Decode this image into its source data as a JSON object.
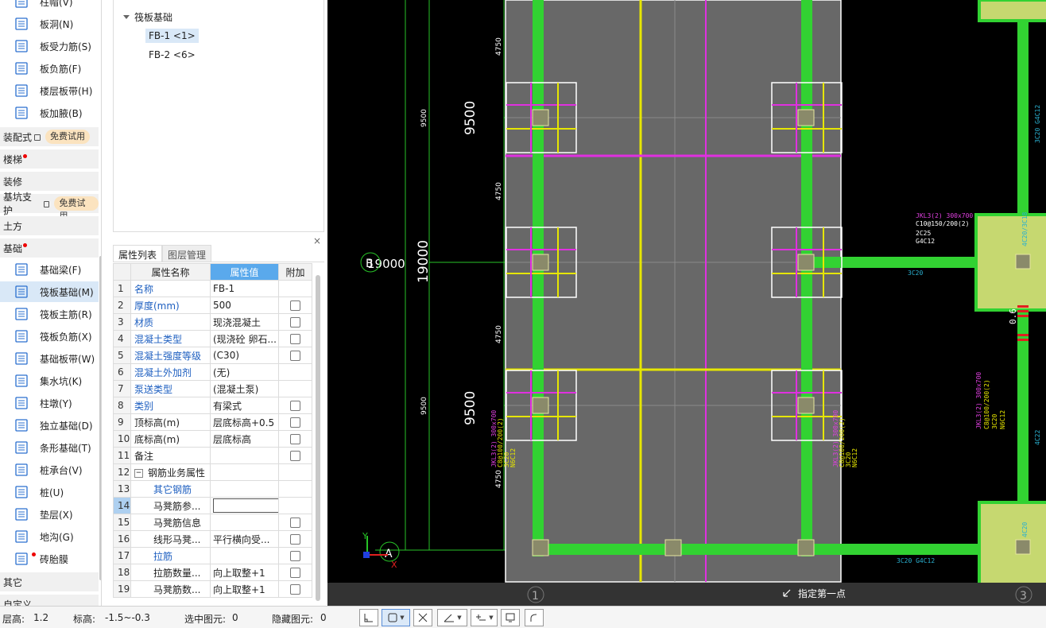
{
  "nav": {
    "top_items": [
      {
        "label": "柱帽(V)",
        "icon": "column-cap-icon"
      },
      {
        "label": "板洞(N)",
        "icon": "slab-hole-icon"
      },
      {
        "label": "板受力筋(S)",
        "icon": "slab-main-rebar-icon"
      },
      {
        "label": "板负筋(F)",
        "icon": "slab-negative-rebar-icon"
      },
      {
        "label": "楼层板带(H)",
        "icon": "floor-strip-icon"
      },
      {
        "label": "板加腋(B)",
        "icon": "slab-haunch-icon"
      }
    ],
    "categories": [
      {
        "label": "装配式",
        "locked": true,
        "trial": "免费试用"
      },
      {
        "label": "楼梯",
        "dot": true
      },
      {
        "label": "装修"
      },
      {
        "label": "基坑支护",
        "locked": true,
        "trial": "免费试用"
      },
      {
        "label": "土方"
      },
      {
        "label": "基础",
        "dot": true
      }
    ],
    "foundation_items": [
      {
        "label": "基础梁(F)",
        "icon": "foundation-beam-icon"
      },
      {
        "label": "筏板基础(M)",
        "icon": "raft-foundation-icon",
        "selected": true
      },
      {
        "label": "筏板主筋(R)",
        "icon": "raft-main-rebar-icon"
      },
      {
        "label": "筏板负筋(X)",
        "icon": "raft-negative-rebar-icon"
      },
      {
        "label": "基础板带(W)",
        "icon": "foundation-strip-icon"
      },
      {
        "label": "集水坑(K)",
        "icon": "sump-pit-icon"
      },
      {
        "label": "柱墩(Y)",
        "icon": "column-pier-icon"
      },
      {
        "label": "独立基础(D)",
        "icon": "isolated-footing-icon"
      },
      {
        "label": "条形基础(T)",
        "icon": "strip-footing-icon"
      },
      {
        "label": "桩承台(V)",
        "icon": "pile-cap-icon"
      },
      {
        "label": "桩(U)",
        "icon": "pile-icon"
      },
      {
        "label": "垫层(X)",
        "icon": "cushion-layer-icon"
      },
      {
        "label": "地沟(G)",
        "icon": "trench-icon"
      },
      {
        "label": "砖胎膜",
        "icon": "brick-mould-icon",
        "dot": true
      }
    ],
    "bottom_categories": [
      {
        "label": "其它"
      },
      {
        "label": "自定义"
      }
    ]
  },
  "tree": {
    "root": "筏板基础",
    "children": [
      {
        "label": "FB-1 <1>",
        "selected": true
      },
      {
        "label": "FB-2 <6>"
      }
    ]
  },
  "props": {
    "close": "×",
    "tabs": [
      {
        "label": "属性列表",
        "active": true
      },
      {
        "label": "图层管理"
      }
    ],
    "headers": {
      "name": "属性名称",
      "value": "属性值",
      "extra": "附加"
    },
    "rows": [
      {
        "n": "1",
        "name": "名称",
        "value": "FB-1",
        "blue": true,
        "check": false
      },
      {
        "n": "2",
        "name": "厚度(mm)",
        "value": "500",
        "blue": true,
        "check": true
      },
      {
        "n": "3",
        "name": "材质",
        "value": "现浇混凝土",
        "blue": true,
        "check": true
      },
      {
        "n": "4",
        "name": "混凝土类型",
        "value": "(现浇砼 卵石...",
        "blue": true,
        "check": true
      },
      {
        "n": "5",
        "name": "混凝土强度等级",
        "value": "(C30)",
        "blue": true,
        "check": true
      },
      {
        "n": "6",
        "name": "混凝土外加剂",
        "value": "(无)",
        "blue": true,
        "check": false
      },
      {
        "n": "7",
        "name": "泵送类型",
        "value": "(混凝土泵)",
        "blue": true,
        "check": false
      },
      {
        "n": "8",
        "name": "类别",
        "value": "有梁式",
        "blue": true,
        "check": true
      },
      {
        "n": "9",
        "name": "顶标高(m)",
        "value": "层底标高+0.5",
        "blue": false,
        "check": true
      },
      {
        "n": "10",
        "name": "底标高(m)",
        "value": "层底标高",
        "blue": false,
        "check": true
      },
      {
        "n": "11",
        "name": "备注",
        "value": "",
        "blue": false,
        "check": true
      },
      {
        "n": "12",
        "name": "钢筋业务属性",
        "value": "",
        "blue": false,
        "check": false,
        "group": true
      },
      {
        "n": "13",
        "name": "其它钢筋",
        "value": "",
        "blue": true,
        "check": false,
        "indent": true
      },
      {
        "n": "14",
        "name": "马凳筋参...",
        "value": "",
        "blue": false,
        "check": false,
        "indent": true,
        "editing": true,
        "current": true
      },
      {
        "n": "15",
        "name": "马凳筋信息",
        "value": "",
        "blue": false,
        "check": true,
        "indent": true
      },
      {
        "n": "16",
        "name": "线形马凳...",
        "value": "平行横向受...",
        "blue": false,
        "check": true,
        "indent": true
      },
      {
        "n": "17",
        "name": "拉筋",
        "value": "",
        "blue": true,
        "check": true,
        "indent": true
      },
      {
        "n": "18",
        "name": "拉筋数量...",
        "value": "向上取整+1",
        "blue": false,
        "check": true,
        "indent": true
      },
      {
        "n": "19",
        "name": "马凳筋数...",
        "value": "向上取整+1",
        "blue": false,
        "check": true,
        "indent": true
      }
    ]
  },
  "canvas": {
    "dims": {
      "d4750": "4750",
      "d9500": "9500",
      "d19000": "19000",
      "b19000": "19000"
    },
    "axis_B": "B",
    "axis_1": "1",
    "axis_3": "3",
    "axis_A": "A",
    "hint": "指定第一点",
    "annot_right": [
      "JKL3(2) 300x700",
      "C10@150/200(2)",
      "2C25",
      "G4C12"
    ],
    "annot_right2": [
      "JKL3(2) 300x700",
      "C8@100/200(2)",
      "3C20",
      "N6C12"
    ],
    "annot_3c20": "3C20",
    "annot_3c20g": "3C20 G4C12",
    "annot_4c20": "4C20",
    "annot_4c20_2": "4C20/3C18",
    "annot_4c22": "4C22",
    "annot_4c12": "3C20 G4C12",
    "annot_h": "0.6"
  },
  "status": {
    "floor_height_label": "层高:",
    "floor_height": "1.2",
    "elev_label": "标高:",
    "elev": "-1.5~-0.3",
    "selected_label": "选中图元:",
    "selected": "0",
    "hidden_label": "隐藏图元:",
    "hidden": "0"
  }
}
